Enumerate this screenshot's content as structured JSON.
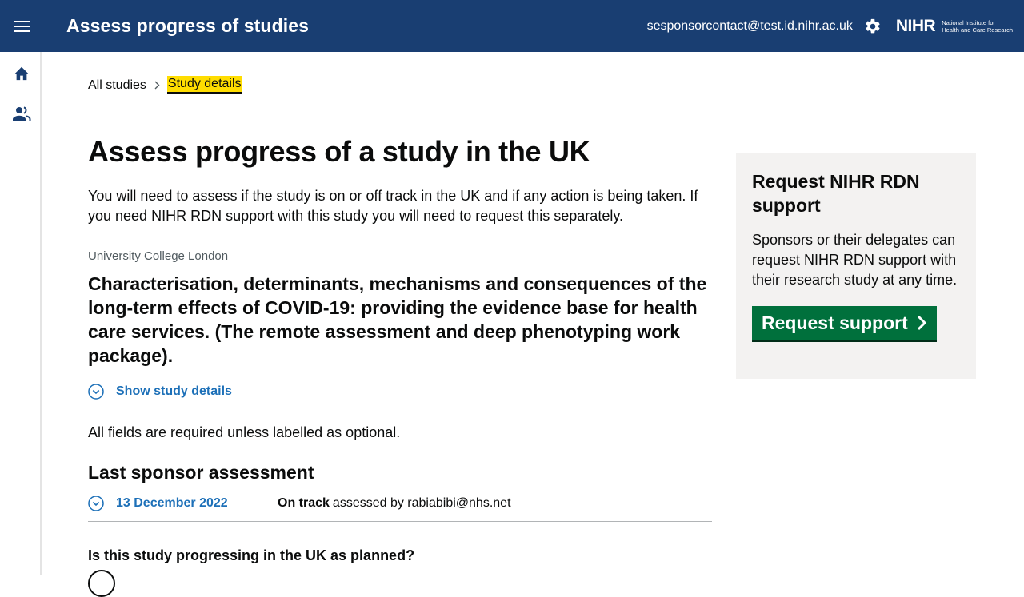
{
  "header": {
    "title": "Assess progress of studies",
    "user_email": "sesponsorcontact@test.id.nihr.ac.uk",
    "logo_main": "NIHR",
    "logo_sub_line1": "National Institute for",
    "logo_sub_line2": "Health and Care Research",
    "icons": [
      "menu-icon",
      "gear-icon"
    ]
  },
  "sidebar": {
    "items": [
      {
        "icon": "home-icon"
      },
      {
        "icon": "people-icon"
      }
    ]
  },
  "breadcrumb": {
    "items": [
      "All studies",
      "Study details"
    ]
  },
  "main": {
    "title": "Assess progress of a study in the UK",
    "intro": "You will need to assess if the study is on or off track in the UK and if any action is being taken. If you need NIHR RDN support with this study you will need to request this separately.",
    "organisation": "University College London",
    "study_title": "Characterisation, determinants, mechanisms and consequences of the long-term effects of COVID-19: providing the evidence base for health care services. (The remote assessment and deep phenotyping work package).",
    "show_details": "Show study details",
    "fields_note": "All fields are required unless labelled as optional.",
    "last_assessment_heading": "Last sponsor assessment",
    "last_assessment": {
      "date": "13 December 2022",
      "status": "On track",
      "assessed_by_text": "assessed by rabiabibi@nhs.net"
    },
    "question": "Is this study progressing in the UK as planned?"
  },
  "panel": {
    "title": "Request NIHR RDN support",
    "text": "Sponsors or their delegates can request NIHR RDN support with their research study at any time.",
    "button_label": "Request support"
  },
  "colors": {
    "header_bg": "#193e72",
    "link_blue": "#1d70b8",
    "highlight": "#ffdd00",
    "button_green": "#00703c",
    "panel_bg": "#f3f2f1"
  }
}
